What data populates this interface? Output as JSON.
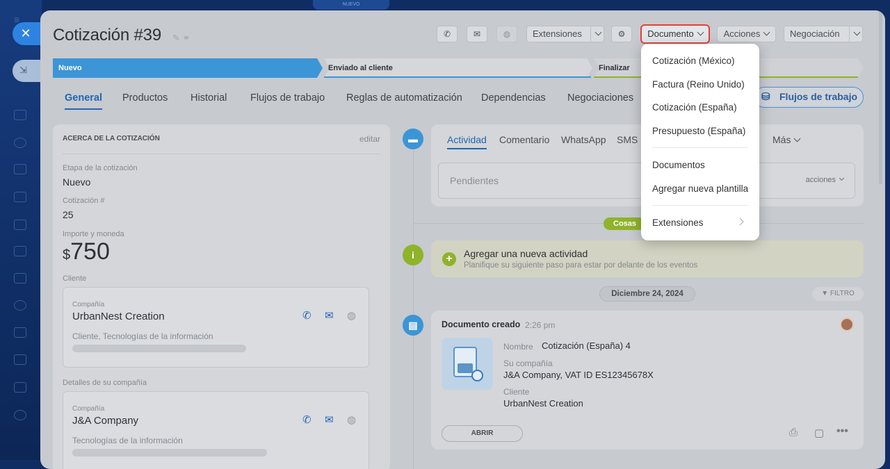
{
  "top_badge": "NUEVO",
  "window": {
    "title": "Cotización #39"
  },
  "header": {
    "extensiones": "Extensiones",
    "documento": "Documento",
    "acciones": "Acciones",
    "negociacion": "Negociación"
  },
  "stages": [
    {
      "label": "Nuevo"
    },
    {
      "label": "Enviado al cliente"
    },
    {
      "label": "Finalizar"
    }
  ],
  "tabs": [
    "General",
    "Productos",
    "Historial",
    "Flujos de trabajo",
    "Reglas de automatización",
    "Dependencias",
    "Negociaciones"
  ],
  "flujos_button": "Flujos de trabajo",
  "about": {
    "heading": "ACERCA DE LA COTIZACIÓN",
    "edit": "editar",
    "stage_label": "Etapa de la cotización",
    "stage_value": "Nuevo",
    "num_label": "Cotización #",
    "num_value": "25",
    "amount_label": "Importe y moneda",
    "currency": "$",
    "amount": "750",
    "client_label": "Cliente",
    "company_label": "Compañía",
    "company_name": "UrbanNest Creation",
    "company_desc": "Cliente, Tecnologías de la información",
    "details_label": "Detalles de su compañía",
    "my_company_label": "Compañía",
    "my_company_name": "J&A Company",
    "my_company_desc": "Tecnologías de la información"
  },
  "activity": {
    "tabs": [
      "Actividad",
      "Comentario",
      "WhatsApp",
      "SMS"
    ],
    "more": "Más",
    "pending": "Pendientes",
    "pending_actions": "acciones",
    "cosas": "Cosas",
    "add_title": "Agregar una nueva actividad",
    "add_sub": "Planifique su siguiente paso para estar por delante de los eventos",
    "date": "Diciembre 24, 2024",
    "filter": "FILTRO"
  },
  "doc_event": {
    "title": "Documento creado",
    "time": "2:26 pm",
    "name_label": "Nombre",
    "name_value": "Cotización (España) 4",
    "company_label": "Su compañía",
    "company_value": "J&A Company, VAT ID ES12345678X",
    "client_label": "Cliente",
    "client_value": "UrbanNest Creation",
    "open": "ABRIR"
  },
  "menu": {
    "items": [
      "Cotización (México)",
      "Factura (Reino Unido)",
      "Cotización (España)",
      "Presupuesto (España)"
    ],
    "items2": [
      "Documentos",
      "Agregar nueva plantilla"
    ],
    "extensions": "Extensiones"
  },
  "colors": {
    "accent": "#2166b3",
    "stage_blue": "#3b95d6",
    "green": "#8fb32a",
    "highlight": "#e2403a"
  }
}
